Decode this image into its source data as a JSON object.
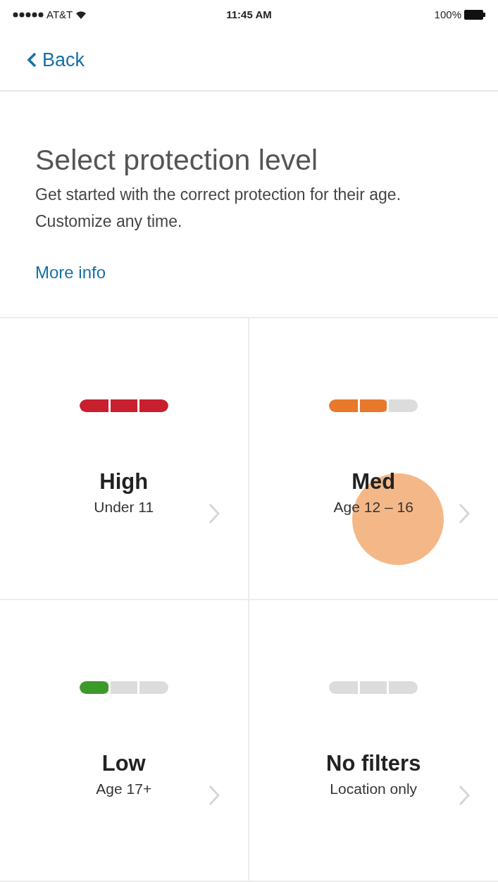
{
  "status_bar": {
    "carrier": "AT&T",
    "time": "11:45 AM",
    "battery": "100%"
  },
  "nav": {
    "back": "Back"
  },
  "header": {
    "title": "Select protection level",
    "description": "Get started with the correct protection for their age. Customize any time.",
    "link": "More info"
  },
  "levels": [
    {
      "label": "High",
      "subtitle": "Under 11",
      "level": 1,
      "color": "#c8202e",
      "pressed": false
    },
    {
      "label": "Med",
      "subtitle": "Age 12 – 16",
      "level": 0.667,
      "color": "#e8782a",
      "pressed": true
    },
    {
      "label": "Low",
      "subtitle": "Age 17+",
      "level": 0.333,
      "color": "#3a9a2a",
      "pressed": false
    },
    {
      "label": "No filters",
      "subtitle": "Location only",
      "pressed": false
    }
  ]
}
